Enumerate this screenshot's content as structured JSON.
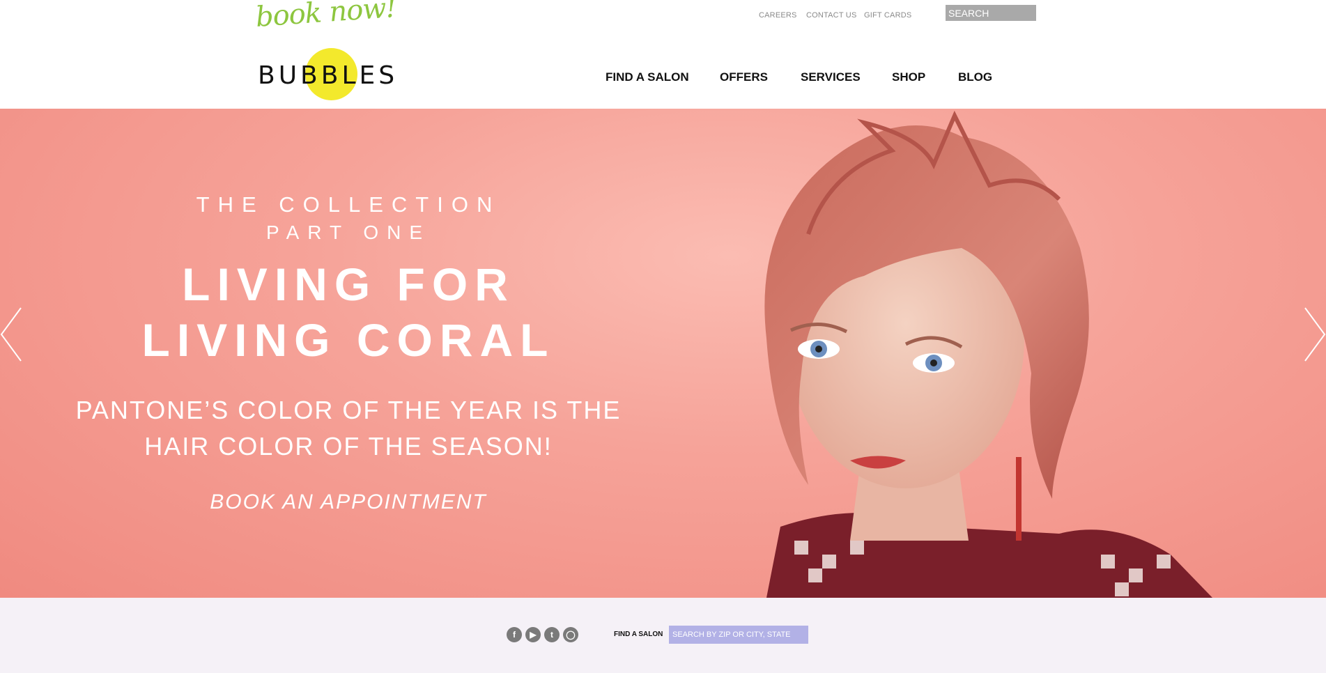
{
  "header": {
    "book_now": "book now!",
    "utility_links": [
      "CAREERS",
      "CONTACT US",
      "GIFT CARDS"
    ],
    "search_value": "SEARCH",
    "logo_text": "BUBBLES",
    "nav": [
      "FIND A SALON",
      "OFFERS",
      "SERVICES",
      "SHOP",
      "BLOG"
    ]
  },
  "hero": {
    "line1": "THE COLLECTION",
    "line2": "PART ONE",
    "headline1": "LIVING FOR",
    "headline2": "LIVING CORAL",
    "sub1": "PANTONE’S COLOR OF THE YEAR IS THE",
    "sub2": "HAIR COLOR OF THE SEASON!",
    "cta": "BOOK AN APPOINTMENT"
  },
  "footer": {
    "social_icons": [
      "facebook-icon",
      "youtube-icon",
      "twitter-icon",
      "instagram-icon"
    ],
    "find_salon_label": "FIND A SALON",
    "find_salon_placeholder": "SEARCH BY ZIP OR CITY, STATE"
  },
  "colors": {
    "brand_yellow": "#f3e92c",
    "book_now_green": "#8dc63f",
    "hero_coral": "#f6a399",
    "footer_bg": "#f5f1f7",
    "footer_input": "#b2b1e6"
  }
}
